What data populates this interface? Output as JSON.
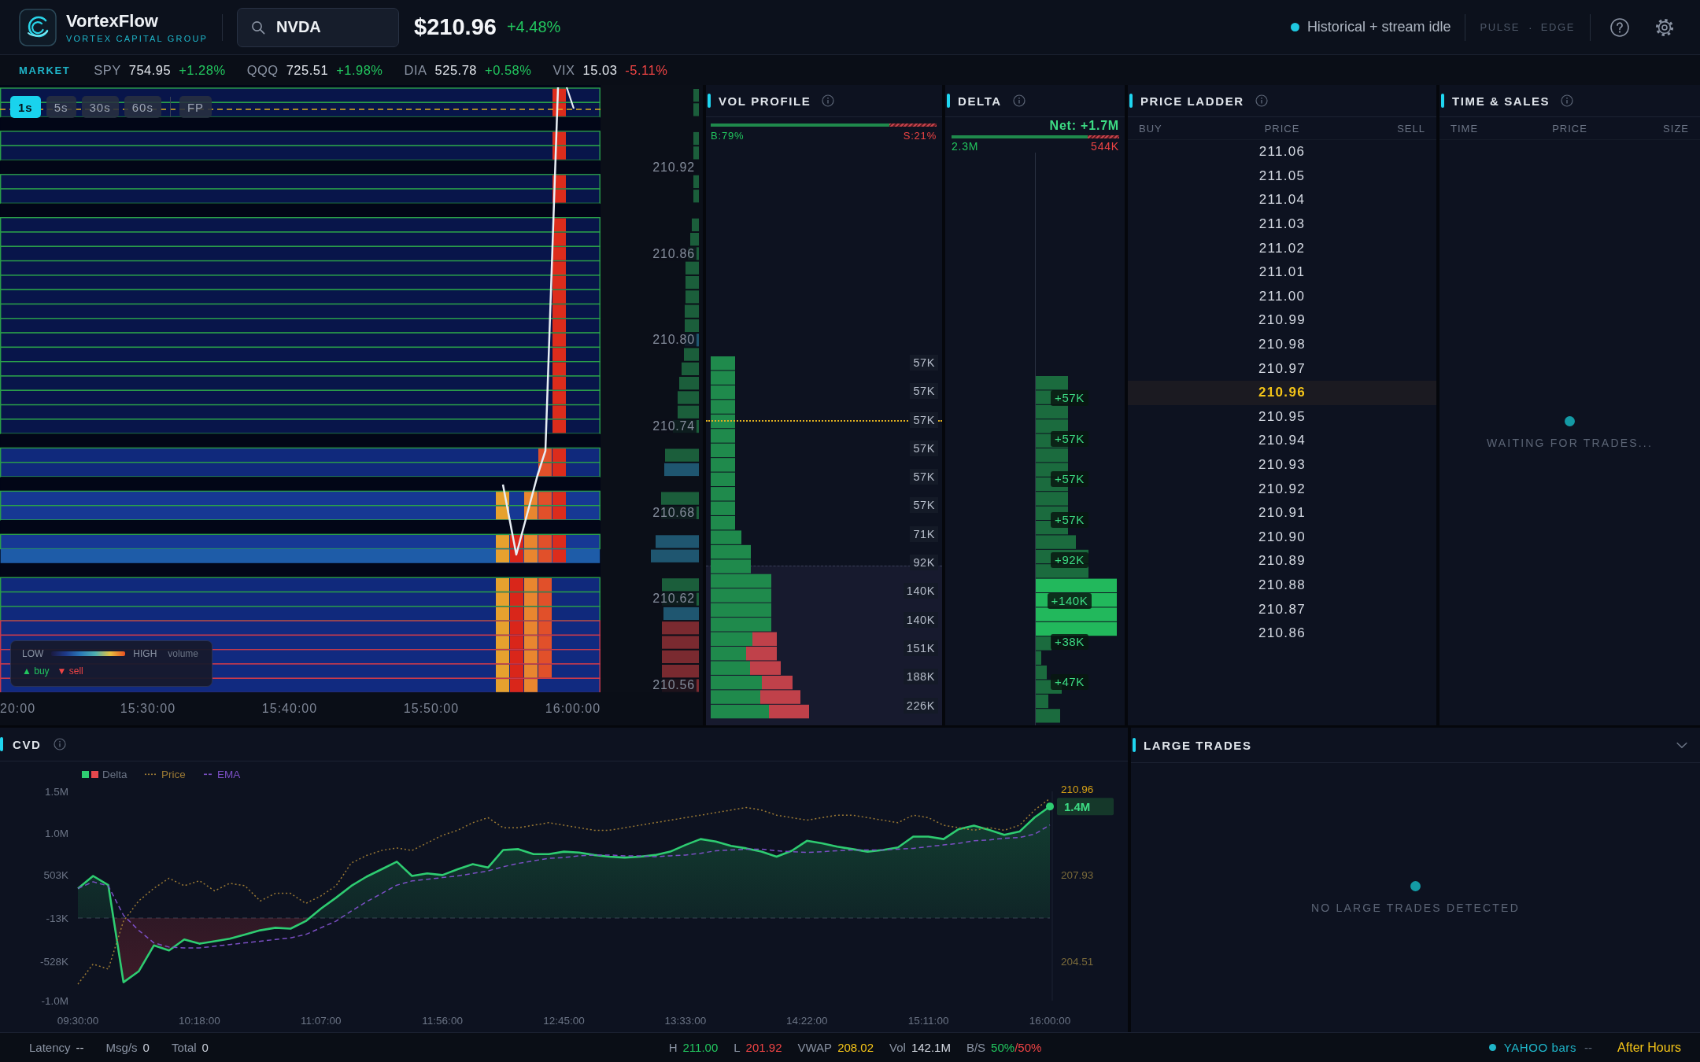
{
  "header": {
    "brand": {
      "name": "VortexFlow",
      "tagline": "VORTEX CAPITAL GROUP"
    },
    "search": {
      "value": "NVDA"
    },
    "quote": {
      "price": "$210.96",
      "change": "+4.48%"
    },
    "status": {
      "text": "Historical + stream idle"
    },
    "modes": [
      {
        "label": "PULSE"
      },
      {
        "label": "EDGE"
      }
    ],
    "mode_separator": "·"
  },
  "market": {
    "label": "MARKET",
    "tickers": [
      {
        "symbol": "SPY",
        "price": "754.95",
        "change": "+1.28%",
        "color": "#22c55e"
      },
      {
        "symbol": "QQQ",
        "price": "725.51",
        "change": "+1.98%",
        "color": "#22c55e"
      },
      {
        "symbol": "DIA",
        "price": "525.78",
        "change": "+0.58%",
        "color": "#22c55e"
      },
      {
        "symbol": "VIX",
        "price": "15.03",
        "change": "-5.11%",
        "color": "#ef4444"
      }
    ]
  },
  "heatmap": {
    "timeframes": [
      {
        "label": "1s",
        "kind": "interval",
        "selected": true
      },
      {
        "label": "5s",
        "kind": "interval",
        "selected": false
      },
      {
        "label": "30s",
        "kind": "interval",
        "selected": false
      },
      {
        "label": "60s",
        "kind": "interval",
        "selected": false
      },
      {
        "label": "FP",
        "kind": "mode",
        "selected": false
      }
    ],
    "price_labels": [
      "210.92",
      "210.86",
      "210.80",
      "210.74",
      "210.68",
      "210.62",
      "210.56"
    ],
    "time_labels": [
      "20:00",
      "15:30:00",
      "15:40:00",
      "15:50:00",
      "16:00:00"
    ],
    "legend": {
      "low": "LOW",
      "high": "HIGH",
      "metric": "volume",
      "buy": "▲ buy",
      "sell": "▼ sell"
    }
  },
  "vol_profile": {
    "title": "VOL PROFILE",
    "buy_label": "B:79%",
    "sell_label": "S:21%",
    "level": 0.79,
    "values": [
      "57K",
      "57K",
      "57K",
      "57K",
      "57K",
      "57K",
      "71K",
      "92K",
      "140K",
      "140K",
      "151K",
      "188K",
      "226K"
    ]
  },
  "delta": {
    "title": "DELTA",
    "net": "Net: +1.7M",
    "buy_total": "2.3M",
    "sell_total": "544K",
    "level": 0.81,
    "values": [
      "+57K",
      "+57K",
      "+57K",
      "+57K",
      "+92K",
      "+140K",
      "+38K",
      "+47K"
    ]
  },
  "price_ladder": {
    "title": "PRICE LADDER",
    "columns": [
      "BUY",
      "PRICE",
      "SELL"
    ],
    "rows": [
      {
        "price": "211.06",
        "selected": false
      },
      {
        "price": "211.05",
        "selected": false
      },
      {
        "price": "211.04",
        "selected": false
      },
      {
        "price": "211.03",
        "selected": false
      },
      {
        "price": "211.02",
        "selected": false
      },
      {
        "price": "211.01",
        "selected": false
      },
      {
        "price": "211.00",
        "selected": false
      },
      {
        "price": "210.99",
        "selected": false
      },
      {
        "price": "210.98",
        "selected": false
      },
      {
        "price": "210.97",
        "selected": false
      },
      {
        "price": "210.96",
        "selected": true
      },
      {
        "price": "210.95",
        "selected": false
      },
      {
        "price": "210.94",
        "selected": false
      },
      {
        "price": "210.93",
        "selected": false
      },
      {
        "price": "210.92",
        "selected": false
      },
      {
        "price": "210.91",
        "selected": false
      },
      {
        "price": "210.90",
        "selected": false
      },
      {
        "price": "210.89",
        "selected": false
      },
      {
        "price": "210.88",
        "selected": false
      },
      {
        "price": "210.87",
        "selected": false
      },
      {
        "price": "210.86",
        "selected": false
      }
    ]
  },
  "time_sales": {
    "title": "TIME & SALES",
    "columns": [
      "TIME",
      "PRICE",
      "SIZE"
    ],
    "empty_text": "WAITING FOR TRADES..."
  },
  "cvd": {
    "title": "CVD",
    "chart_data": {
      "type": "area",
      "legend": "top-left",
      "categories": [
        "09:30:00",
        null,
        null,
        null,
        null,
        null,
        null,
        null,
        "10:18:00",
        null,
        null,
        null,
        null,
        null,
        null,
        null,
        "11:07:00",
        null,
        null,
        null,
        null,
        null,
        null,
        null,
        "11:56:00",
        null,
        null,
        null,
        null,
        null,
        null,
        null,
        "12:45:00",
        null,
        null,
        null,
        null,
        null,
        null,
        null,
        "13:33:00",
        null,
        null,
        null,
        null,
        null,
        null,
        null,
        "14:22:00",
        null,
        null,
        null,
        null,
        null,
        null,
        null,
        "15:11:00",
        null,
        null,
        null,
        null,
        null,
        null,
        null,
        "16:00:00"
      ],
      "ylim": [
        -1000000,
        1500000
      ],
      "y2lim": [
        202.95,
        211.24
      ],
      "yticks": [
        {
          "value": 1500000,
          "label": "1.5M"
        },
        {
          "value": 1000000,
          "label": "1.0M"
        },
        {
          "value": 503000,
          "label": "503K"
        },
        {
          "value": -13000,
          "label": "-13K"
        },
        {
          "value": -528000,
          "label": "-528K"
        },
        {
          "value": -1000000,
          "label": "-1.0M"
        }
      ],
      "y2ticks": [
        {
          "value": 207.93,
          "label": "207.93"
        },
        {
          "value": 204.51,
          "label": "204.51"
        }
      ],
      "series": [
        {
          "name": "Delta",
          "color": "#2ecc71",
          "type": "area",
          "line_style": "solid",
          "values": [
            340000,
            490000,
            380000,
            -780000,
            -650000,
            -340000,
            -400000,
            -270000,
            -320000,
            -290000,
            -260000,
            -210000,
            -160000,
            -130000,
            -140000,
            -50000,
            100000,
            230000,
            370000,
            480000,
            570000,
            660000,
            490000,
            520000,
            500000,
            570000,
            630000,
            590000,
            800000,
            810000,
            750000,
            750000,
            780000,
            770000,
            740000,
            720000,
            710000,
            720000,
            740000,
            780000,
            860000,
            930000,
            900000,
            850000,
            820000,
            780000,
            720000,
            790000,
            910000,
            880000,
            840000,
            810000,
            780000,
            800000,
            830000,
            960000,
            960000,
            930000,
            1050000,
            1090000,
            1040000,
            980000,
            1020000,
            1190000,
            1320000
          ]
        },
        {
          "name": "Price",
          "color": "#9c7a34",
          "type": "line",
          "line_style": "dotted",
          "axis": "y2",
          "values": [
            203.6,
            204.4,
            204.2,
            206.1,
            206.9,
            207.4,
            207.8,
            207.5,
            207.7,
            207.3,
            207.6,
            207.5,
            206.9,
            207.2,
            207.2,
            206.8,
            207.1,
            207.5,
            208.4,
            208.7,
            208.9,
            209.0,
            208.9,
            209.2,
            209.5,
            209.7,
            210.0,
            210.2,
            209.8,
            209.8,
            209.9,
            210.0,
            209.9,
            209.8,
            209.7,
            209.7,
            209.8,
            209.9,
            210.0,
            210.1,
            210.2,
            210.3,
            210.4,
            210.5,
            210.6,
            210.5,
            210.3,
            210.2,
            210.1,
            210.2,
            210.3,
            210.3,
            210.2,
            210.1,
            210.0,
            210.3,
            210.2,
            209.9,
            209.8,
            209.7,
            209.8,
            209.7,
            209.9,
            210.5,
            210.96
          ]
        },
        {
          "name": "EMA",
          "color": "#7b4fc4",
          "type": "line",
          "line_style": "dashed",
          "values": [
            340000,
            420000,
            370000,
            20000,
            -160000,
            -310000,
            -360000,
            -370000,
            -370000,
            -350000,
            -330000,
            -310000,
            -290000,
            -270000,
            -250000,
            -210000,
            -130000,
            -50000,
            70000,
            180000,
            280000,
            380000,
            430000,
            450000,
            470000,
            490000,
            520000,
            550000,
            600000,
            640000,
            670000,
            700000,
            710000,
            730000,
            740000,
            740000,
            730000,
            730000,
            720000,
            730000,
            740000,
            760000,
            790000,
            800000,
            810000,
            810000,
            790000,
            780000,
            770000,
            780000,
            790000,
            800000,
            800000,
            800000,
            810000,
            820000,
            840000,
            860000,
            880000,
            910000,
            920000,
            940000,
            950000,
            990000,
            1100000
          ]
        }
      ],
      "ref_lines": [
        {
          "value": -13000,
          "axis": "y"
        }
      ],
      "annotations": [
        "1.4M",
        "210.96"
      ]
    }
  },
  "large_trades": {
    "title": "LARGE TRADES",
    "empty_text": "NO LARGE TRADES DETECTED"
  },
  "status_bar": {
    "metrics": [
      {
        "label": "Latency",
        "value": "--"
      },
      {
        "label": "Msg/s",
        "value": "0"
      },
      {
        "label": "Total",
        "value": "0"
      }
    ],
    "stats": [
      {
        "label": "H",
        "value": "211.00",
        "color": "#22c55e"
      },
      {
        "label": "L",
        "value": "201.92",
        "color": "#ef4444"
      },
      {
        "label": "VWAP",
        "value": "208.02",
        "color": "#f5c518"
      },
      {
        "label": "Vol",
        "value": "142.1M",
        "color": "#d5dae3"
      }
    ],
    "buy_sell": {
      "label": "B/S",
      "buy": "50%",
      "separator": "/",
      "sell": "50%"
    },
    "source": {
      "name": "YAHOO bars",
      "value": "--"
    },
    "session": "After Hours"
  }
}
